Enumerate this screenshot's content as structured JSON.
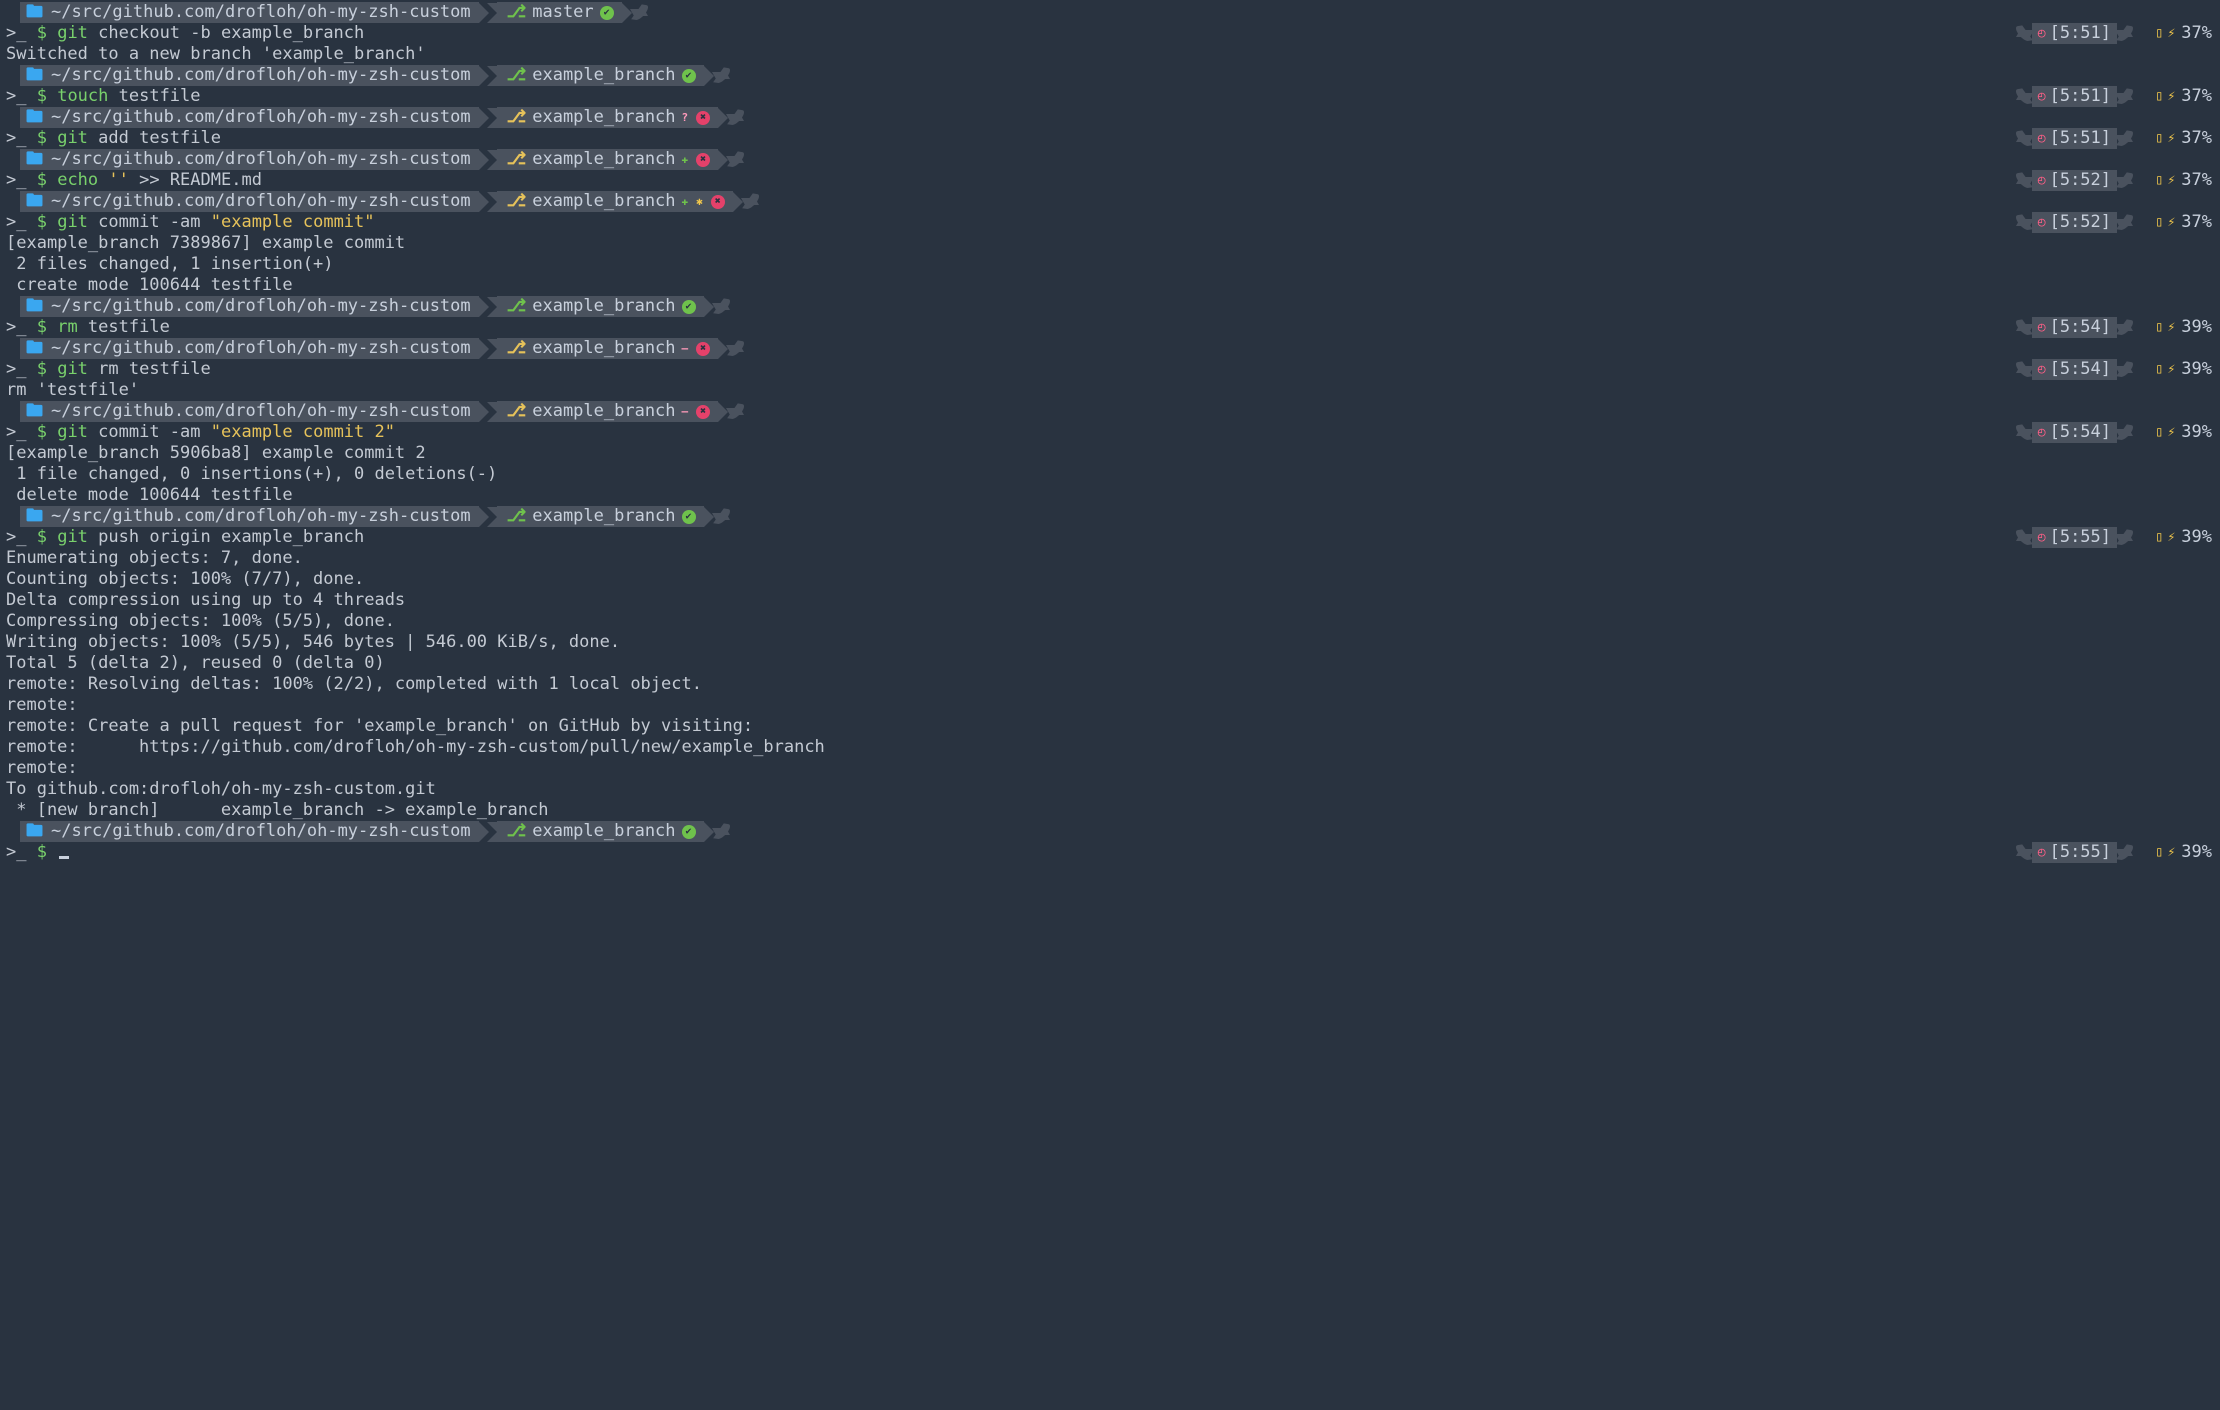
{
  "cwd": "~/src/github.com/drofloh/oh-my-zsh-custom",
  "prompt_symbol": ">_ $",
  "branches": {
    "master": "master",
    "example": "example_branch"
  },
  "rprompts": [
    {
      "time": "[5:51]",
      "pct": "37%"
    },
    {
      "time": "[5:51]",
      "pct": "37%"
    },
    {
      "time": "[5:51]",
      "pct": "37%"
    },
    {
      "time": "[5:52]",
      "pct": "37%"
    },
    {
      "time": "[5:52]",
      "pct": "37%"
    },
    {
      "time": "[5:54]",
      "pct": "39%"
    },
    {
      "time": "[5:54]",
      "pct": "39%"
    },
    {
      "time": "[5:54]",
      "pct": "39%"
    },
    {
      "time": "[5:55]",
      "pct": "39%"
    },
    {
      "time": "[5:55]",
      "pct": "39%"
    }
  ],
  "lines": {
    "c1": {
      "cmd": "git",
      "rest": " checkout -b example_branch"
    },
    "o1": "Switched to a new branch 'example_branch'",
    "c2": {
      "cmd": "touch",
      "rest": " testfile"
    },
    "c3": {
      "cmd": "git",
      "rest": " add testfile"
    },
    "c4a": {
      "cmd": "echo",
      "str": " ''",
      "rest": " >> README.md"
    },
    "c5": {
      "cmd": "git",
      "rest": " commit -am ",
      "str": "\"example commit\""
    },
    "o5a": "[example_branch 7389867] example commit",
    "o5b": " 2 files changed, 1 insertion(+)",
    "o5c": " create mode 100644 testfile",
    "c6": {
      "cmd": "rm",
      "rest": " testfile"
    },
    "c7": {
      "cmd": "git",
      "rest": " rm testfile"
    },
    "o7": "rm 'testfile'",
    "c8": {
      "cmd": "git",
      "rest": " commit -am ",
      "str": "\"example commit 2\""
    },
    "o8a": "[example_branch 5906ba8] example commit 2",
    "o8b": " 1 file changed, 0 insertions(+), 0 deletions(-)",
    "o8c": " delete mode 100644 testfile",
    "c9": {
      "cmd": "git",
      "rest": " push origin example_branch"
    },
    "o9a": "Enumerating objects: 7, done.",
    "o9b": "Counting objects: 100% (7/7), done.",
    "o9c": "Delta compression using up to 4 threads",
    "o9d": "Compressing objects: 100% (5/5), done.",
    "o9e": "Writing objects: 100% (5/5), 546 bytes | 546.00 KiB/s, done.",
    "o9f": "Total 5 (delta 2), reused 0 (delta 0)",
    "o9g": "remote: Resolving deltas: 100% (2/2), completed with 1 local object.",
    "o9h": "remote:",
    "o9i": "remote: Create a pull request for 'example_branch' on GitHub by visiting:",
    "o9j": "remote:      https://github.com/drofloh/oh-my-zsh-custom/pull/new/example_branch",
    "o9k": "remote:",
    "o9l": "To github.com:drofloh/oh-my-zsh-custom.git",
    "o9m": " * [new branch]      example_branch -> example_branch"
  }
}
